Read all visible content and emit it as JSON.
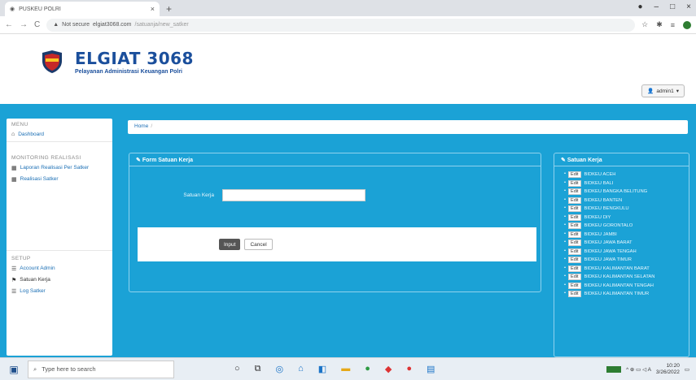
{
  "browser": {
    "tab_title": "PUSKEU POLRI",
    "url_warn": "Not secure",
    "url_domain": "elgiat3068.com",
    "url_path": "/satuanja/new_satker"
  },
  "header": {
    "brand_title": "ELGIAT 3068",
    "brand_subtitle": "Pelayanan Administrasi Keuangan Polri",
    "user_label": "admin1"
  },
  "sidebar": {
    "menu_header": "MENU",
    "dashboard": "Dashboard",
    "monitoring_header": "MONITORING REALISASI",
    "laporan": "Laporan Realisasi Per Satker",
    "realisasi": "Realisasi Satker",
    "setup_header": "SETUP",
    "account": "Account Admin",
    "satuan": "Satuan Kerja",
    "log": "Log Satker"
  },
  "breadcrumb": {
    "home": "Home"
  },
  "form": {
    "title": "Form Satuan Kerja",
    "label": "Satuan Kerja",
    "input_value": "",
    "submit": "Input",
    "cancel": "Cancel"
  },
  "list": {
    "title": "Satuan Kerja",
    "edit_label": "Edit",
    "items": [
      "BIDKEU ACEH",
      "BIDKEU BALI",
      "BIDKEU BANGKA BELITUNG",
      "BIDKEU BANTEN",
      "BIDKEU BENGKULU",
      "BIDKEU DIY",
      "BIDKEU GORONTALO",
      "BIDKEU JAMBI",
      "BIDKEU JAWA BARAT",
      "BIDKEU JAWA TENGAH",
      "BIDKEU JAWA TIMUR",
      "BIDKEU KALIMANTAN BARAT",
      "BIDKEU KALIMANTAN SELATAN",
      "BIDKEU KALIMANTAN TENGAH",
      "BIDKEU KALIMANTAN TIMUR"
    ]
  },
  "taskbar": {
    "search_placeholder": "Type here to search",
    "time": "10:20",
    "date": "3/26/2022"
  }
}
